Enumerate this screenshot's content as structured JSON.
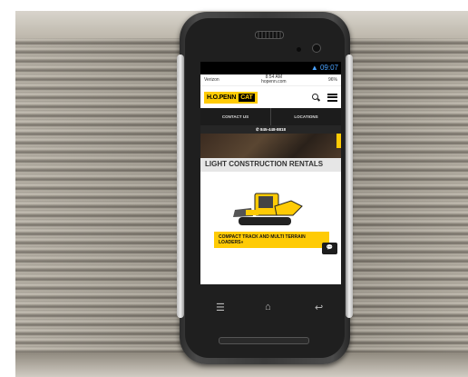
{
  "android_status": {
    "time": "09:07"
  },
  "browser_status": {
    "carrier": "Verizon",
    "time": "8:54 AM",
    "url": "hopenn.com",
    "battery": "96%"
  },
  "header": {
    "logo_text": "H.O.PENN",
    "logo_badge": "CAT"
  },
  "nav": {
    "contact": "CONTACT US",
    "locations": "LOCATIONS"
  },
  "phone": "845-448-8818",
  "section_title": "LIGHT CONSTRUCTION RENTALS",
  "product_label": "COMPACT TRACK AND MULTI TERRAIN LOADERS»",
  "colors": {
    "brand_yellow": "#ffcb05",
    "nav_bg": "#1c1c1c"
  },
  "icons": [
    "search-icon",
    "menu-icon",
    "chat-icon",
    "recent-apps-icon",
    "home-icon",
    "back-icon"
  ]
}
